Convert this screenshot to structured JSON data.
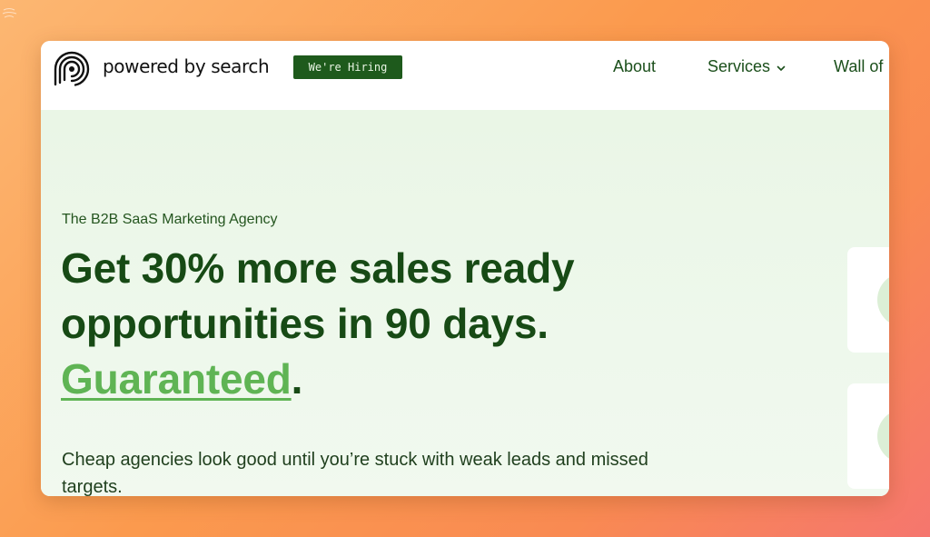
{
  "brand": {
    "name": "powered by search",
    "hiring_badge": "We're Hiring"
  },
  "nav": {
    "items": [
      {
        "label": "About"
      },
      {
        "label": "Services"
      },
      {
        "label": "Wall of"
      }
    ]
  },
  "hero": {
    "eyebrow": "The B2B SaaS Marketing Agency",
    "headline_line1": "Get 30% more sales ready",
    "headline_line2": "opportunities in 90 days.",
    "headline_link": "Guaranteed",
    "headline_period": ".",
    "subtext": "Cheap agencies look good until you’re stuck with weak leads and missed targets."
  },
  "colors": {
    "brand_green": "#1e5a1c",
    "link_green": "#5fb454",
    "hero_bg": "#eaf6e6",
    "background_gradient_start": "#fcb772",
    "background_gradient_end": "#f5766e"
  },
  "icons": {
    "logo": "fingerprint-logo-icon",
    "services_dropdown": "chevron-down-icon"
  }
}
